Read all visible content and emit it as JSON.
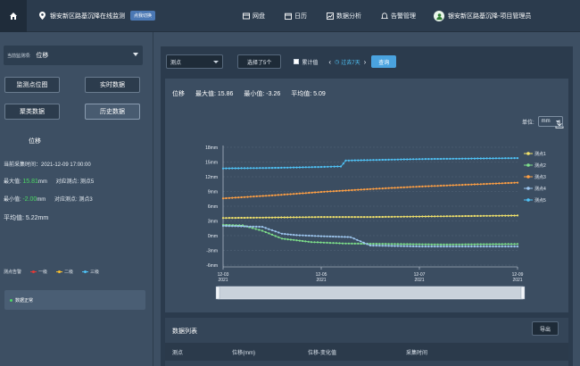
{
  "header": {
    "location": "银安新区路基沉降在线监测",
    "env_tag": "点我切换",
    "nav": [
      {
        "label": "网盘",
        "icon": "disk-icon"
      },
      {
        "label": "日历",
        "icon": "calendar-icon"
      },
      {
        "label": "数据分析",
        "icon": "analysis-icon"
      },
      {
        "label": "告警管理",
        "icon": "alarm-icon"
      }
    ],
    "user": "银安新区路基沉降-项目管理员"
  },
  "left": {
    "monitor_label": "当前监测项:",
    "monitor_value": "位移",
    "buttons": [
      "监测点位图",
      "实时数据",
      "聚类数据",
      "历史数据"
    ],
    "section_title": "位移",
    "collect_time": "当前采集时间：2021-12-09 17:00:00",
    "max_label": "最大值:",
    "max_value": "15.81",
    "max_unit": "mm",
    "max_point": "对应测点: 测点5",
    "min_label": "最小值:",
    "min_value": "-2.00",
    "min_unit": "mm",
    "min_point": "对应测点: 测点3",
    "avg": "平均值: 5.22mm",
    "alarm_label": "测点告警",
    "alarm_levels": [
      {
        "label": "一级",
        "color": "#e53935"
      },
      {
        "label": "二级",
        "color": "#fbc02d"
      },
      {
        "label": "三级",
        "color": "#4fc3f7"
      }
    ],
    "status": "数据正常"
  },
  "toolbar": {
    "dropdown": "测点",
    "select_btn": "选择了5个",
    "accumulate": "累计值",
    "day_label": "过去7天",
    "query": "查询"
  },
  "chart_stats": {
    "title": "位移",
    "max": "最大值: 15.86",
    "min": "最小值: -3.26",
    "avg": "平均值: 5.09"
  },
  "unit": {
    "label": "单位:",
    "value": "mm"
  },
  "table": {
    "title": "数据列表",
    "export": "导出",
    "columns": [
      "测点",
      "位移(mm)",
      "位移-变化值",
      "采集时间"
    ]
  },
  "chart_data": {
    "type": "line",
    "ylim": [
      -6,
      18
    ],
    "yticks": [
      "18mm",
      "15mm",
      "12mm",
      "9mm",
      "6mm",
      "3mm",
      "0mm",
      "-3mm",
      "-6mm"
    ],
    "xticks": [
      [
        "12-03",
        "2021"
      ],
      [
        "12-05",
        "2021"
      ],
      [
        "12-07",
        "2021"
      ],
      [
        "12-09",
        "2021"
      ]
    ],
    "x_range_days": [
      0,
      6
    ],
    "series": [
      {
        "name": "测点1",
        "color": "#f3e36a",
        "values": [
          [
            0,
            3.6
          ],
          [
            1,
            3.7
          ],
          [
            2,
            3.8
          ],
          [
            3,
            3.8
          ],
          [
            4,
            3.9
          ],
          [
            5,
            4.0
          ],
          [
            6,
            4.1
          ]
        ]
      },
      {
        "name": "测点2",
        "color": "#7ee08a",
        "values": [
          [
            0,
            2.2
          ],
          [
            0.4,
            2.1
          ],
          [
            0.8,
            1.0
          ],
          [
            1.2,
            -0.6
          ],
          [
            1.8,
            -1.3
          ],
          [
            2.5,
            -1.6
          ],
          [
            3.5,
            -1.7
          ],
          [
            4.5,
            -1.8
          ],
          [
            6,
            -1.7
          ]
        ]
      },
      {
        "name": "测点3",
        "color": "#ff9f43",
        "values": [
          [
            0,
            7.6
          ],
          [
            1,
            8.2
          ],
          [
            2,
            8.9
          ],
          [
            3,
            9.5
          ],
          [
            4,
            10.0
          ],
          [
            5,
            10.4
          ],
          [
            6,
            10.8
          ]
        ]
      },
      {
        "name": "测点4",
        "color": "#9ec7f0",
        "values": [
          [
            0,
            2.0
          ],
          [
            0.8,
            1.8
          ],
          [
            1.2,
            0.4
          ],
          [
            1.5,
            0.1
          ],
          [
            2.0,
            -0.1
          ],
          [
            2.6,
            -0.3
          ],
          [
            3.0,
            -2.0
          ],
          [
            4,
            -2.2
          ],
          [
            6,
            -2.2
          ]
        ]
      },
      {
        "name": "测点5",
        "color": "#4fc3f7",
        "values": [
          [
            0,
            13.7
          ],
          [
            1,
            13.8
          ],
          [
            2,
            14.0
          ],
          [
            2.4,
            14.1
          ],
          [
            2.5,
            15.3
          ],
          [
            3,
            15.4
          ],
          [
            4,
            15.6
          ],
          [
            5,
            15.7
          ],
          [
            6,
            15.8
          ]
        ]
      }
    ]
  }
}
